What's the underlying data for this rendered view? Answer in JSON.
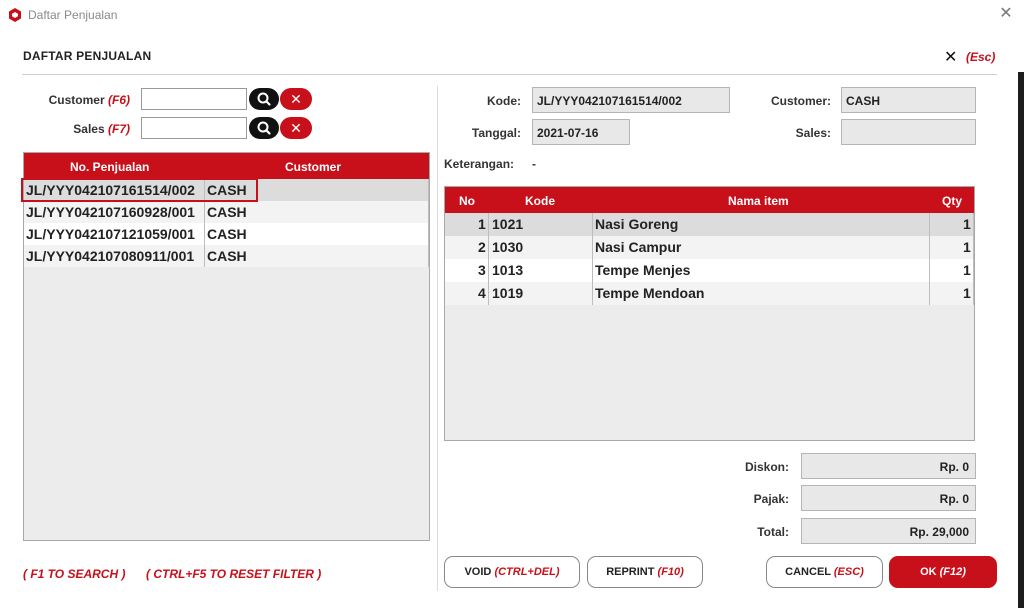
{
  "window": {
    "title": "Daftar Penjualan",
    "close_glyph": "✕",
    "accent_color": "#c8101b"
  },
  "header": {
    "title": "DAFTAR PENJUALAN",
    "close_glyph": "✕",
    "esc_label": "(Esc)"
  },
  "filters": {
    "customer": {
      "label": "Customer",
      "key": "(F6)",
      "value": "",
      "clear_glyph": "✕"
    },
    "sales": {
      "label": "Sales",
      "key": "(F7)",
      "value": "",
      "clear_glyph": "✕"
    }
  },
  "sales_list": {
    "columns": [
      "No. Penjualan",
      "Customer"
    ],
    "rows": [
      {
        "no": "JL/YYY042107161514/002",
        "customer": "CASH",
        "selected": true
      },
      {
        "no": "JL/YYY042107160928/001",
        "customer": "CASH",
        "selected": false
      },
      {
        "no": "JL/YYY042107121059/001",
        "customer": "CASH",
        "selected": false
      },
      {
        "no": "JL/YYY042107080911/001",
        "customer": "CASH",
        "selected": false
      }
    ]
  },
  "detail": {
    "kode_label": "Kode:",
    "kode": "JL/YYY042107161514/002",
    "customer_label": "Customer:",
    "customer": "CASH",
    "tanggal_label": "Tanggal:",
    "tanggal": "2021-07-16",
    "sales_label": "Sales:",
    "sales": "",
    "keterangan_label": "Keterangan:",
    "keterangan": "-"
  },
  "items": {
    "columns": [
      "No",
      "Kode",
      "Nama item",
      "Qty"
    ],
    "rows": [
      {
        "no": "1",
        "kode": "1021",
        "nama": "Nasi Goreng",
        "qty": "1",
        "selected": true
      },
      {
        "no": "2",
        "kode": "1030",
        "nama": "Nasi Campur",
        "qty": "1",
        "selected": false
      },
      {
        "no": "3",
        "kode": "1013",
        "nama": "Tempe Menjes",
        "qty": "1",
        "selected": false
      },
      {
        "no": "4",
        "kode": "1019",
        "nama": "Tempe Mendoan",
        "qty": "1",
        "selected": false
      }
    ]
  },
  "totals": {
    "diskon_label": "Diskon:",
    "diskon": "Rp. 0",
    "pajak_label": "Pajak:",
    "pajak": "Rp. 0",
    "total_label": "Total:",
    "total": "Rp. 29,000"
  },
  "footer": {
    "hint_search": "( F1 TO SEARCH )",
    "hint_reset": "( CTRL+F5 TO RESET FILTER )",
    "void_label": "VOID",
    "void_key": "(CTRL+DEL)",
    "reprint_label": "REPRINT",
    "reprint_key": "(F10)",
    "cancel_label": "CANCEL",
    "cancel_key": "(ESC)",
    "ok_label": "OK",
    "ok_key": "(F12)"
  }
}
